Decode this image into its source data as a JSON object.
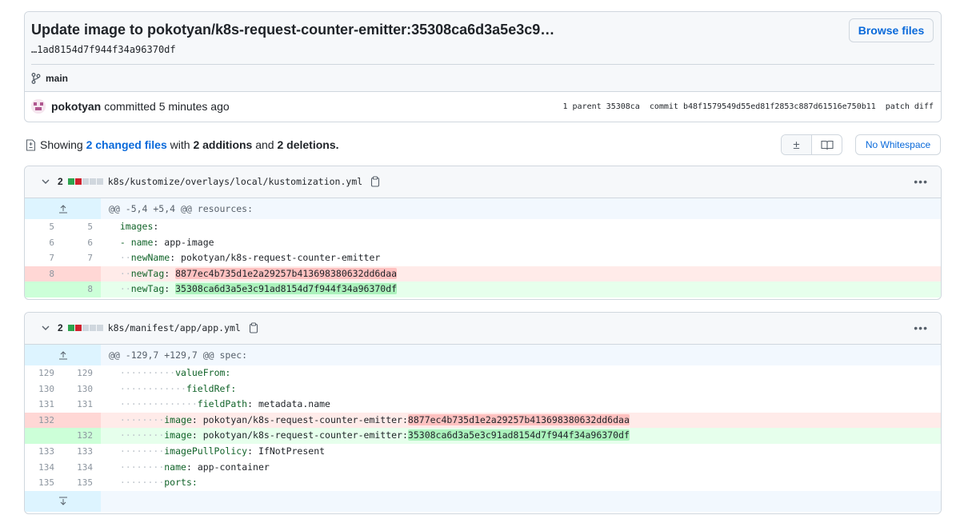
{
  "commit": {
    "title": "Update image to pokotyan/k8s-request-counter-emitter:35308ca6d3a5e3c9…",
    "subtitle": "…1ad8154d7f944f34a96370df",
    "browse_label": "Browse files",
    "branch": "main",
    "author": "pokotyan",
    "action": "committed 5 minutes ago",
    "parent_text": "1 parent 35308ca",
    "commit_text": "commit b48f1579549d55ed81f2853c887d61516e750b11",
    "patch_text": "patch diff"
  },
  "toolbar": {
    "showing": "Showing",
    "changed_files": "2 changed files",
    "with": "with",
    "additions": "2 additions",
    "and": "and",
    "deletions": "2 deletions.",
    "no_whitespace": "No Whitespace",
    "icons": [
      "diff-unified-icon",
      "book-split-icon"
    ]
  },
  "colors": {
    "accent": "#0969da",
    "add": "#2da44e",
    "del": "#cf222e",
    "neutral": "#d0d7de"
  },
  "files": [
    {
      "count": "2",
      "path": "k8s/kustomize/overlays/local/kustomization.yml",
      "hunk": "@@ -5,4 +5,4 @@ resources:"
    },
    {
      "count": "2",
      "path": "k8s/manifest/app/app.yml",
      "hunk": "@@ -129,7 +129,7 @@ spec:"
    }
  ],
  "file1_lines": [
    {
      "old": "5",
      "new": "5",
      "key": "images",
      "sep": ":",
      "val": ""
    },
    {
      "old": "6",
      "new": "6",
      "key": "- name",
      "sep": ": ",
      "val": "app-image"
    },
    {
      "old": "7",
      "new": "7",
      "key": "newName",
      "sep": ": ",
      "val": "pokotyan/k8s-request-counter-emitter"
    },
    {
      "old": "8",
      "new": "",
      "key": "newTag",
      "sep": ": ",
      "val": "8877ec4b735d1e2a29257b413698380632dd6daa"
    },
    {
      "old": "",
      "new": "8",
      "key": "newTag",
      "sep": ": ",
      "val": "35308ca6d3a5e3c91ad8154d7f944f34a96370df"
    }
  ],
  "file2_lines": [
    {
      "old": "129",
      "new": "129",
      "text": "valueFrom:"
    },
    {
      "old": "130",
      "new": "130",
      "text": "fieldRef:"
    },
    {
      "old": "131",
      "new": "131",
      "key": "fieldPath",
      "val": "metadata.name"
    },
    {
      "old": "132",
      "new": "",
      "key": "image",
      "val": "pokotyan/k8s-request-counter-emitter:",
      "hl": "8877ec4b735d1e2a29257b413698380632dd6daa"
    },
    {
      "old": "",
      "new": "132",
      "key": "image",
      "val": "pokotyan/k8s-request-counter-emitter:",
      "hl": "35308ca6d3a5e3c91ad8154d7f944f34a96370df"
    },
    {
      "old": "133",
      "new": "133",
      "key": "imagePullPolicy",
      "val": "IfNotPresent"
    },
    {
      "old": "134",
      "new": "134",
      "key": "name",
      "val": "app-container"
    },
    {
      "old": "135",
      "new": "135",
      "text": "ports:"
    }
  ]
}
